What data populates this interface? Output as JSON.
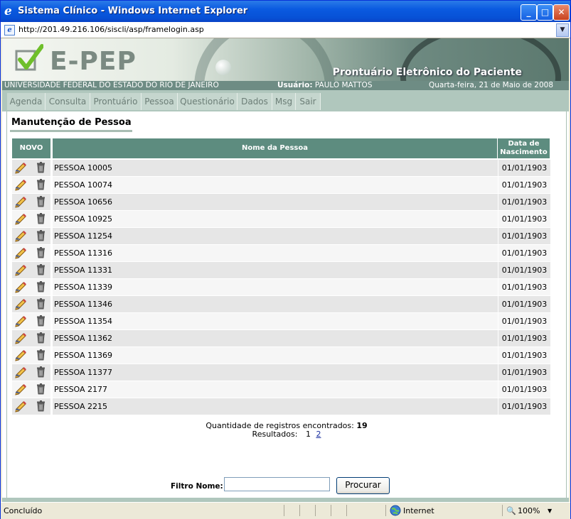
{
  "window": {
    "title": "Sistema Clínico - Windows Internet Explorer"
  },
  "address": {
    "url": "http://201.49.216.106/siscli/asp/framelogin.asp"
  },
  "banner": {
    "logo": "E-PEP",
    "subtitle": "Prontuário Eletrônico do Paciente",
    "university": "UNIVERSIDADE FEDERAL DO ESTADO DO RIO DE JANEIRO",
    "user_label": "Usuário:",
    "user_name": "PAULO MATTOS",
    "date": "Quarta-feira, 21 de Maio de 2008"
  },
  "nav": [
    "Agenda",
    "Consulta",
    "Prontuário",
    "Pessoa",
    "Questionário",
    "Dados",
    "Msg",
    "Sair"
  ],
  "page": {
    "title": "Manutenção de Pessoa"
  },
  "table": {
    "col_new": "NOVO",
    "col_name": "Nome da Pessoa",
    "col_date": "Data de Nascimento",
    "rows": [
      {
        "name": "PESSOA 10005",
        "date": "01/01/1903"
      },
      {
        "name": "PESSOA 10074",
        "date": "01/01/1903"
      },
      {
        "name": "PESSOA 10656",
        "date": "01/01/1903"
      },
      {
        "name": "PESSOA 10925",
        "date": "01/01/1903"
      },
      {
        "name": "PESSOA 11254",
        "date": "01/01/1903"
      },
      {
        "name": "PESSOA 11316",
        "date": "01/01/1903"
      },
      {
        "name": "PESSOA 11331",
        "date": "01/01/1903"
      },
      {
        "name": "PESSOA 11339",
        "date": "01/01/1903"
      },
      {
        "name": "PESSOA 11346",
        "date": "01/01/1903"
      },
      {
        "name": "PESSOA 11354",
        "date": "01/01/1903"
      },
      {
        "name": "PESSOA 11362",
        "date": "01/01/1903"
      },
      {
        "name": "PESSOA 11369",
        "date": "01/01/1903"
      },
      {
        "name": "PESSOA 11377",
        "date": "01/01/1903"
      },
      {
        "name": "PESSOA 2177",
        "date": "01/01/1903"
      },
      {
        "name": "PESSOA 2215",
        "date": "01/01/1903"
      }
    ]
  },
  "summary": {
    "count_label": "Quantidade de registros encontrados:",
    "count": "19",
    "results_label": "Resultados:",
    "pages": [
      "1",
      "2"
    ]
  },
  "filter": {
    "label": "Filtro Nome:",
    "value": "",
    "button": "Procurar"
  },
  "status": {
    "text": "Concluído",
    "zone": "Internet",
    "zoom": "100%"
  },
  "colors": {
    "header_green": "#5d8c7f",
    "row_odd": "#e6e6e6",
    "row_even": "#f6f6f6",
    "nav_bg": "#b0c7bd"
  }
}
